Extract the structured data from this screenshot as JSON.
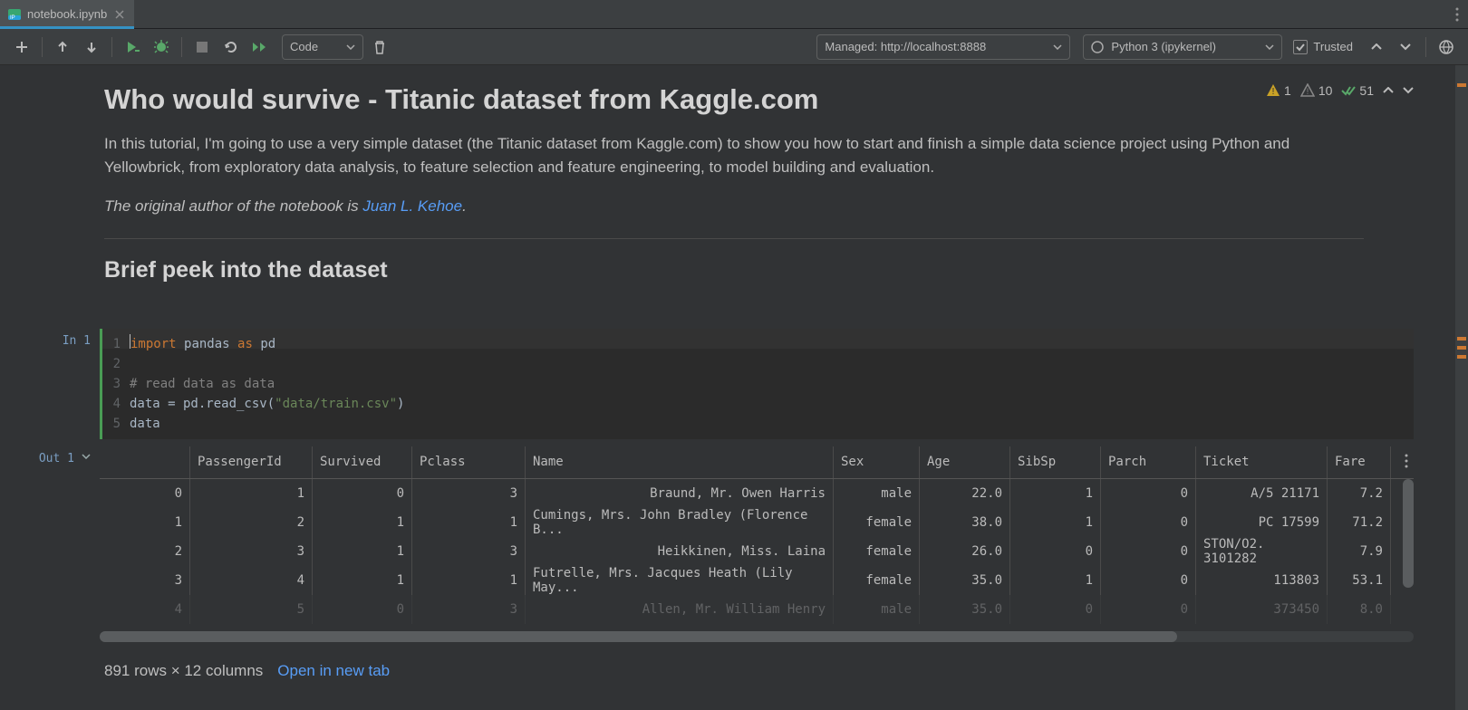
{
  "tab": {
    "title": "notebook.ipynb"
  },
  "toolbar": {
    "cell_type": "Code",
    "server": "Managed: http://localhost:8888",
    "kernel": "Python 3 (ipykernel)",
    "trusted": "Trusted"
  },
  "status": {
    "warn_bang": "1",
    "warn_tri": "10",
    "ok_checks": "51"
  },
  "md": {
    "h1": "Who would survive - Titanic dataset from Kaggle.com",
    "p1": "In this tutorial, I'm going to use a very simple dataset (the Titanic dataset from Kaggle.com) to show you how to start and finish a simple data science project using Python and Yellowbrick, from exploratory data analysis, to feature selection and feature engineering, to model building and evaluation.",
    "p2_prefix": "The original author of the notebook is ",
    "p2_link": "Juan L. Kehoe",
    "p2_suffix": ".",
    "h2": "Brief peek into the dataset"
  },
  "cell": {
    "in_label": "In 1",
    "out_label": "Out 1",
    "code": {
      "l1_kw1": "import",
      "l1_id": "pandas",
      "l1_kw2": "as",
      "l1_al": "pd",
      "l3": "# read data as data",
      "l4_a": "data = pd.read_csv(",
      "l4_s": "\"data/train.csv\"",
      "l4_b": ")",
      "l5": "data"
    }
  },
  "table": {
    "headers": {
      "pid": "PassengerId",
      "surv": "Survived",
      "pcl": "Pclass",
      "name": "Name",
      "sex": "Sex",
      "age": "Age",
      "sib": "SibSp",
      "par": "Parch",
      "tic": "Ticket",
      "fare": "Fare"
    },
    "rows": [
      {
        "idx": "0",
        "pid": "1",
        "surv": "0",
        "pcl": "3",
        "name": "Braund, Mr. Owen Harris",
        "sex": "male",
        "age": "22.0",
        "sib": "1",
        "par": "0",
        "tic": "A/5 21171",
        "fare": "7.2"
      },
      {
        "idx": "1",
        "pid": "2",
        "surv": "1",
        "pcl": "1",
        "name": "Cumings, Mrs. John Bradley (Florence B...",
        "sex": "female",
        "age": "38.0",
        "sib": "1",
        "par": "0",
        "tic": "PC 17599",
        "fare": "71.2"
      },
      {
        "idx": "2",
        "pid": "3",
        "surv": "1",
        "pcl": "3",
        "name": "Heikkinen, Miss. Laina",
        "sex": "female",
        "age": "26.0",
        "sib": "0",
        "par": "0",
        "tic": "STON/O2. 3101282",
        "fare": "7.9"
      },
      {
        "idx": "3",
        "pid": "4",
        "surv": "1",
        "pcl": "1",
        "name": "Futrelle, Mrs. Jacques Heath (Lily May...",
        "sex": "female",
        "age": "35.0",
        "sib": "1",
        "par": "0",
        "tic": "113803",
        "fare": "53.1"
      },
      {
        "idx": "4",
        "pid": "5",
        "surv": "0",
        "pcl": "3",
        "name": "Allen, Mr. William Henry",
        "sex": "male",
        "age": "35.0",
        "sib": "0",
        "par": "0",
        "tic": "373450",
        "fare": "8.0"
      }
    ]
  },
  "footer": {
    "summary": "891 rows × 12 columns",
    "link": "Open in new tab"
  }
}
